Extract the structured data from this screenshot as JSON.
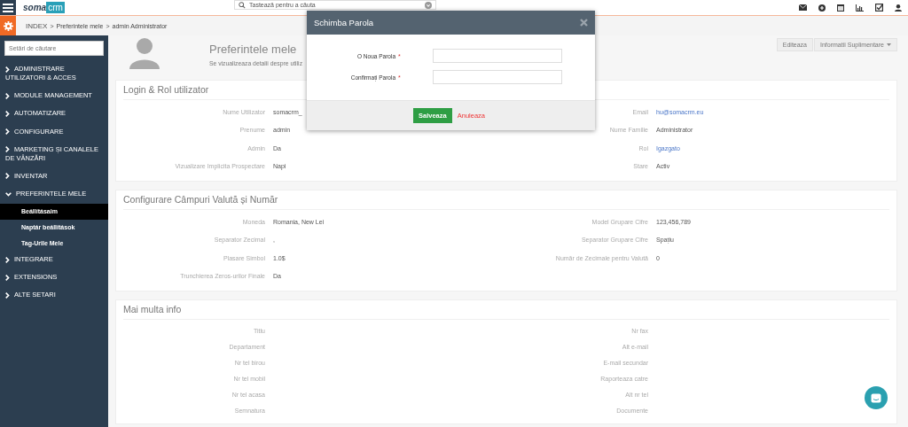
{
  "topbar": {
    "logo": {
      "part_1": "soma",
      "part_2": "crm"
    },
    "search": {
      "placeholder": "Tastează pentru a căuta"
    }
  },
  "breadcrumb": {
    "separator": ">",
    "items": [
      "INDEX",
      "Preferintele mele",
      "admin Administrator"
    ]
  },
  "sidebar": {
    "search": {
      "placeholder": "Setări de căutare"
    },
    "items": [
      {
        "label": "ADMINISTRARE UTILIZATORI & ACCES",
        "expanded": false
      },
      {
        "label": "MODULE MANAGEMENT",
        "expanded": false
      },
      {
        "label": "AUTOMATIZARE",
        "expanded": false
      },
      {
        "label": "CONFIGURARE",
        "expanded": false
      },
      {
        "label": "MARKETING ȘI CANALELE DE VÂNZĂRI",
        "expanded": false
      },
      {
        "label": "INVENTAR",
        "expanded": false
      },
      {
        "label": "PREFERINTELE MELE",
        "expanded": true,
        "children": [
          {
            "label": "Beállításaim",
            "selected": true
          },
          {
            "label": "Naptár beállítások",
            "selected": false
          },
          {
            "label": "Tag-Urile Mele",
            "selected": false
          }
        ]
      },
      {
        "label": "INTEGRARE",
        "expanded": false
      },
      {
        "label": "EXTENSIONS",
        "expanded": false
      },
      {
        "label": "ALTE SETARI",
        "expanded": false
      }
    ]
  },
  "header": {
    "title": "Preferintele mele",
    "subtitle": "Se vizualizeaza detalii despre utiliz",
    "buttons": [
      {
        "label": "Editeaza",
        "dropdown": false
      },
      {
        "label": "Informatii Suplimentare",
        "dropdown": true
      }
    ]
  },
  "sections": [
    {
      "title": "Login & Rol utilizator",
      "left": [
        {
          "label": "Nume Utilizator",
          "value": "somacrm_",
          "link": false
        },
        {
          "label": "Prenume",
          "value": "admin",
          "link": false
        },
        {
          "label": "Admin",
          "value": "Da",
          "link": false
        },
        {
          "label": "Vizualizare Implicita Prospectare",
          "value": "Napi",
          "link": false
        }
      ],
      "right": [
        {
          "label": "Email",
          "value": "hu@somacrm.eu",
          "link": true
        },
        {
          "label": "Nume Familie",
          "value": "Administrator",
          "link": false
        },
        {
          "label": "Rol",
          "value": "Igazgato",
          "link": true
        },
        {
          "label": "Stare",
          "value": "Activ",
          "link": false
        }
      ]
    },
    {
      "title": "Configurare Câmpuri Valută și Număr",
      "left": [
        {
          "label": "Moneda",
          "value": "Romania, New Lei",
          "link": false
        },
        {
          "label": "Separator Zecimal",
          "value": ",",
          "link": false
        },
        {
          "label": "Plasare Simbol",
          "value": "1.0$",
          "link": false
        },
        {
          "label": "Trunchierea Zeros-urilor Finale",
          "value": "Da",
          "link": false
        }
      ],
      "right": [
        {
          "label": "Model Grupare Cifre",
          "value": "123,456,789",
          "link": false
        },
        {
          "label": "Separator Grupare Cifre",
          "value": "Spațiu",
          "link": false
        },
        {
          "label": "Număr de Zecimale pentru Valută",
          "value": "0",
          "link": false
        }
      ]
    },
    {
      "title": "Mai multa info",
      "left": [
        {
          "label": "Titlu"
        },
        {
          "label": "Departament"
        },
        {
          "label": "Nr tel birou"
        },
        {
          "label": "Nr tel mobil"
        },
        {
          "label": "Nr tel acasa"
        },
        {
          "label": "Semnatura"
        }
      ],
      "right": [
        {
          "label": "Nr fax"
        },
        {
          "label": "Alt e-mail"
        },
        {
          "label": "E-mail secundar"
        },
        {
          "label": "Raporteaza catre"
        },
        {
          "label": "Alt nr tel"
        },
        {
          "label": "Documente"
        }
      ]
    }
  ],
  "modal": {
    "title": "Schimba Parola",
    "required_mark": "*",
    "fields": [
      {
        "label": "O Noua Parola",
        "required": true
      },
      {
        "label": "Confirmați Parola",
        "required": true
      }
    ],
    "save": "Salveaza",
    "cancel": "Anuleaza"
  }
}
